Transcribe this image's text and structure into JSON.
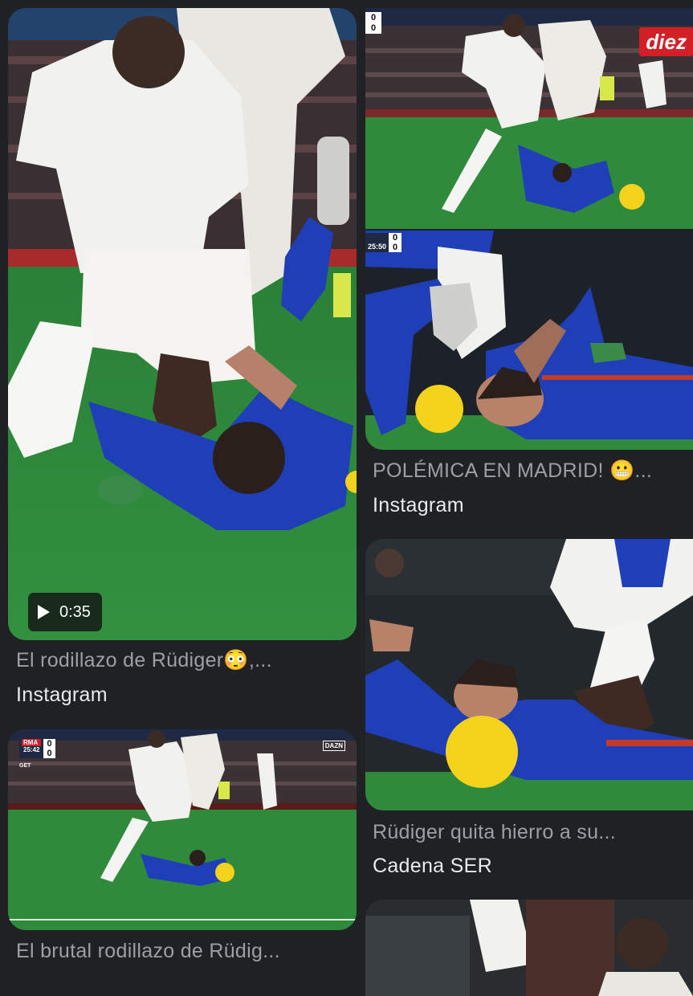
{
  "results": [
    {
      "title": "El rodillazo de Rüdiger😳,...",
      "source": "Instagram",
      "video_duration": "0:35",
      "icon": "play-icon"
    },
    {
      "title": "",
      "source": "",
      "scoreboard": {
        "home": "0",
        "away": "0"
      },
      "overlay_logo": "diez"
    },
    {
      "title": "POLÉMICA EN MADRID! 😬...",
      "source": "Instagram",
      "scoreboard": {
        "time": "25:50",
        "home": "0",
        "away": "0"
      }
    },
    {
      "title": "Rüdiger quita hierro a su...",
      "source": "Cadena SER"
    },
    {
      "title": "El brutal rodillazo de Rüdig...",
      "source": "",
      "scoreboard": {
        "home_team": "RMA",
        "away_team": "GET",
        "time": "25:42",
        "home": "0",
        "away": "0"
      },
      "overlay_logo": "DAZN"
    }
  ],
  "colors": {
    "background": "#202124",
    "title": "#9aa0a6",
    "source": "#e8eaed",
    "pitch": "#2f8a3c",
    "madrid_kit": "#f1f1ee",
    "getafe_kit": "#1f3fb8",
    "ball": "#f2d21b"
  }
}
